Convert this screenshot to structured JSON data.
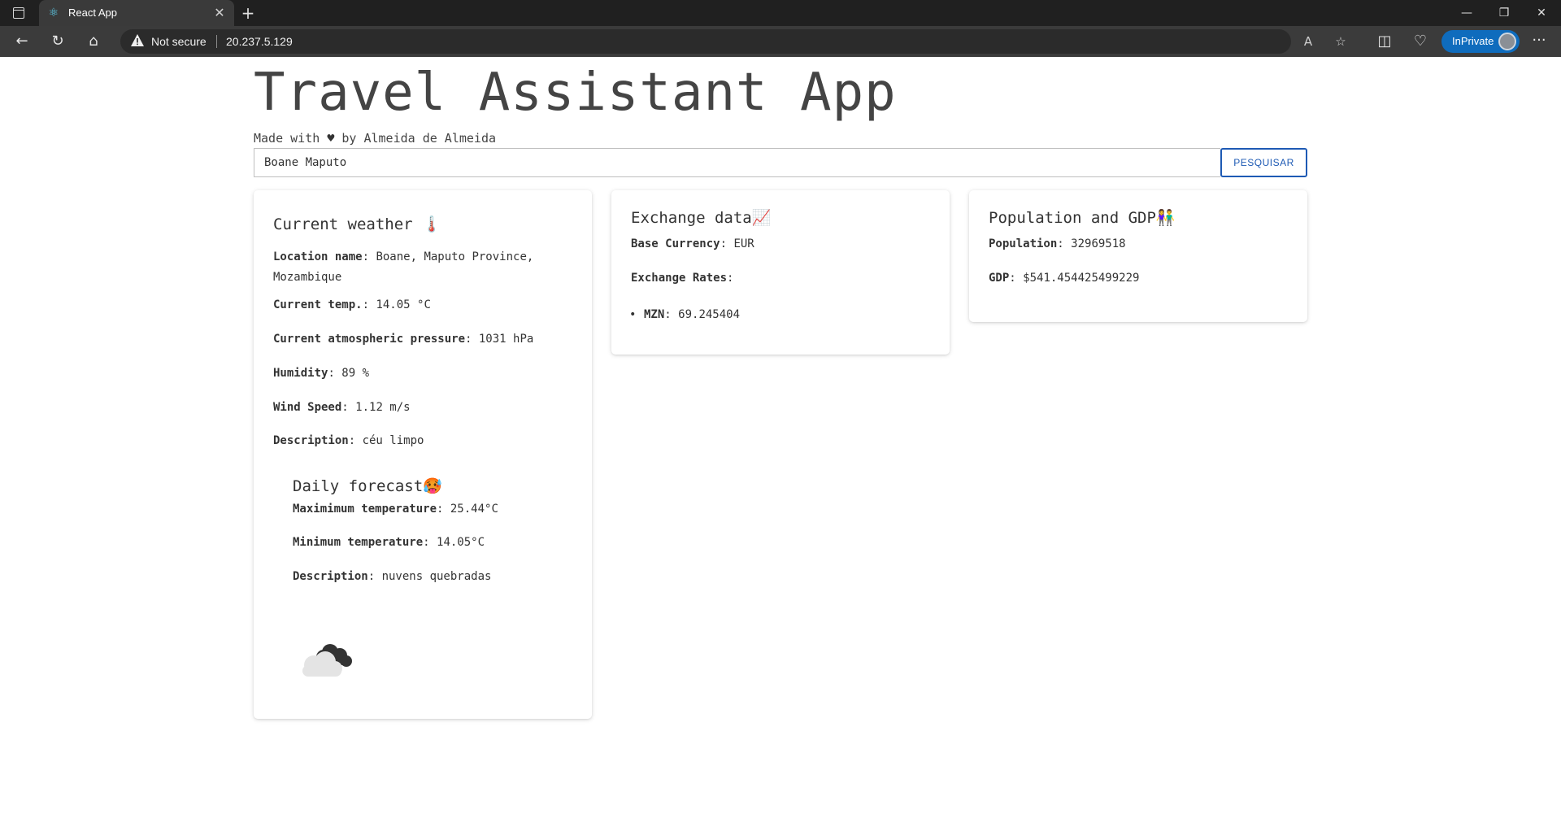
{
  "browser": {
    "tab_title": "React App",
    "not_secure": "Not secure",
    "url": "20.237.5.129",
    "inprivate": "InPrivate"
  },
  "app": {
    "title": "Travel Assistant App",
    "made_with_prefix": "Made with",
    "made_with_suffix": "by Almeida de Almeida"
  },
  "search": {
    "value": "Boane Maputo",
    "button": "PESQUISAR"
  },
  "weather": {
    "heading": "Current weather",
    "heading_emoji": "🌡️",
    "location_label": "Location name",
    "location_value": "Boane, Maputo Province, Mozambique",
    "temp_label": "Current temp.",
    "temp_value": "14.05 °C",
    "pressure_label": "Current atmospheric pressure",
    "pressure_value": "1031 hPa",
    "humidity_label": "Humidity",
    "humidity_value": "89 %",
    "wind_label": "Wind Speed",
    "wind_value": "1.12 m/s",
    "description_label": "Description",
    "description_value": "céu limpo"
  },
  "forecast": {
    "heading": "Daily forecast",
    "heading_emoji": "🥵",
    "max_label": "Maximimum temperature",
    "max_value": "25.44°C",
    "min_label": "Minimum temperature",
    "min_value": "14.05°C",
    "description_label": "Description",
    "description_value": "nuvens quebradas",
    "icon": "broken-clouds-icon"
  },
  "exchange": {
    "heading": "Exchange data",
    "heading_emoji": "📈",
    "base_label": "Base Currency",
    "base_value": "EUR",
    "rates_label": "Exchange Rates",
    "rates": [
      {
        "code": "MZN",
        "value": "69.245404"
      }
    ]
  },
  "population": {
    "heading": "Population and GDP",
    "heading_emoji": "👫",
    "population_label": "Population",
    "population_value": "32969518",
    "gdp_label": "GDP",
    "gdp_value": "$541.454425499229"
  },
  "colors": {
    "accent": "#1e5ab4",
    "inprivate": "#0f6cbd"
  }
}
